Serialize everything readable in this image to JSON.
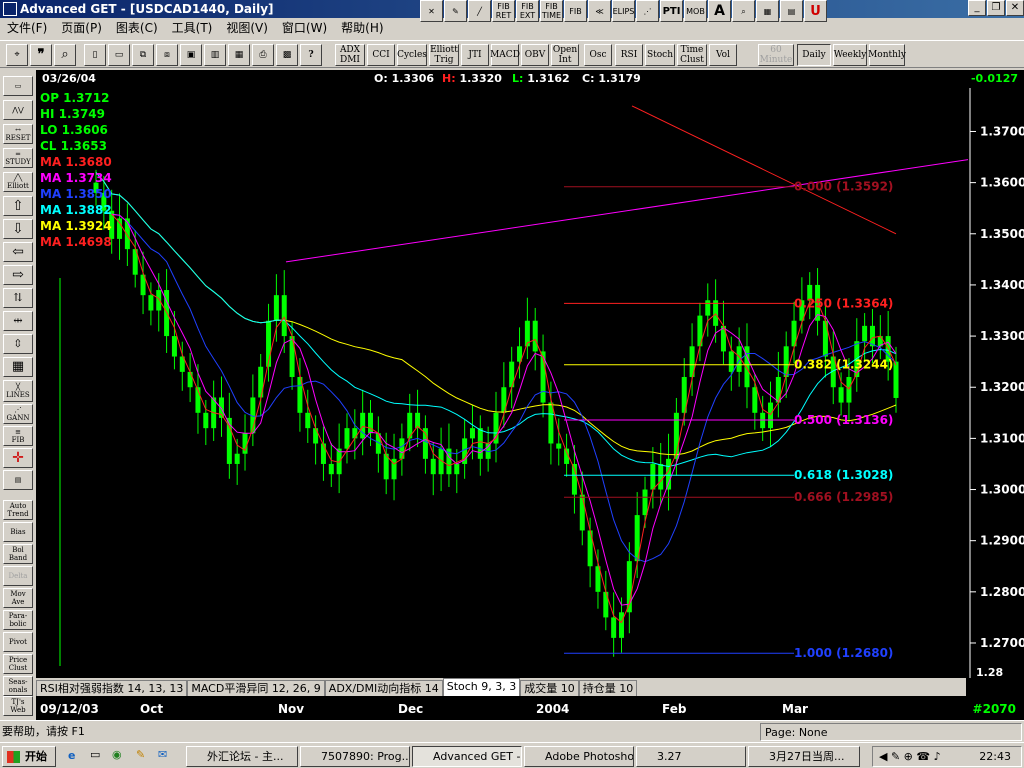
{
  "window": {
    "title": "Advanced GET - [USDCAD1440, Daily]"
  },
  "menu": [
    "文件(F)",
    "页面(P)",
    "图表(C)",
    "工具(T)",
    "视图(V)",
    "窗口(W)",
    "帮助(H)"
  ],
  "top_tools": [
    "FIB RET",
    "FIB EXT",
    "FIB TIME",
    "FIB",
    "ELIPS",
    "PTI",
    "MOB",
    "A"
  ],
  "toolbar2": {
    "indicators": [
      "ADX DMI",
      "CCI",
      "Cycles",
      "Elliott Trig",
      "JTI",
      "MACD",
      "OBV",
      "Open Int",
      "Osc",
      "RSI",
      "Stoch",
      "Time Clust",
      "Vol"
    ],
    "periods": [
      "60 Minute",
      "Daily",
      "Weekly",
      "Monthly"
    ]
  },
  "sidebar": {
    "labels_top": [
      "RESET",
      "STUDY",
      "Elliott",
      "LINES",
      "GANN",
      "FIB"
    ],
    "labels_bottom": [
      "Auto Trend",
      "Bias",
      "Bol Band",
      "Delta",
      "Mov Ave",
      "Para-bolic",
      "Pivot",
      "Price Clust",
      "Seas-onals",
      "TJ's Web"
    ]
  },
  "chart_header": {
    "date": "03/26/04",
    "open_label": "O:",
    "open": "1.3306",
    "high_label": "H:",
    "high": "1.3320",
    "low_label": "L:",
    "low": "1.3162",
    "close_label": "C:",
    "close": "1.3179",
    "change": "-0.0127"
  },
  "legend": [
    {
      "label": "OP",
      "value": "1.3712",
      "color": "#00ff00"
    },
    {
      "label": "HI",
      "value": "1.3749",
      "color": "#00ff00"
    },
    {
      "label": "LO",
      "value": "1.3606",
      "color": "#00ff00"
    },
    {
      "label": "CL",
      "value": "1.3653",
      "color": "#00ff00"
    },
    {
      "label": "MA",
      "value": "1.3680",
      "color": "#ff2020"
    },
    {
      "label": "MA",
      "value": "1.3734",
      "color": "#ff00ff"
    },
    {
      "label": "MA",
      "value": "1.3850",
      "color": "#2040ff"
    },
    {
      "label": "MA",
      "value": "1.3882",
      "color": "#00ffff"
    },
    {
      "label": "MA",
      "value": "1.3924",
      "color": "#ffff00"
    },
    {
      "label": "MA",
      "value": "1.4698",
      "color": "#ff2020"
    }
  ],
  "fib_levels": [
    {
      "label": "0.000 (1.3592)",
      "price": 1.3592,
      "color": "#a01020"
    },
    {
      "label": "0.250 (1.3364)",
      "price": 1.3364,
      "color": "#ff2020"
    },
    {
      "label": "0.382 (1.3244)",
      "price": 1.3244,
      "color": "#ffff00"
    },
    {
      "label": "0.500 (1.3136)",
      "price": 1.3136,
      "color": "#ff00ff"
    },
    {
      "label": "0.618 (1.3028)",
      "price": 1.3028,
      "color": "#00ffff"
    },
    {
      "label": "0.666 (1.2985)",
      "price": 1.2985,
      "color": "#a01020"
    },
    {
      "label": "1.000 (1.2680)",
      "price": 1.268,
      "color": "#2040ff"
    }
  ],
  "study_tabs": [
    "RSI相对强弱指数 14, 13, 13",
    "MACD平滑异同 12, 26, 9",
    "ADX/DMI动向指标 14",
    "Stoch 9, 3, 3",
    "成交量 10",
    "持仓量 10"
  ],
  "date_axis": {
    "start": "09/12/03",
    "ticks": [
      "Oct",
      "Nov",
      "Dec",
      "2004",
      "Feb",
      "Mar"
    ],
    "bar_no": "#2070"
  },
  "status": {
    "help": "要帮助，请按 F1",
    "page": "Page: None"
  },
  "taskbar": {
    "start": "开始",
    "tasks": [
      "外汇论坛 - 主...",
      "7507890: Prog...",
      "Advanced GET -...",
      "Adobe Photoshop",
      "3.27",
      "3月27日当周..."
    ],
    "clock": "22:43"
  },
  "chart_data": {
    "type": "candlestick",
    "symbol": "USDCAD",
    "period": "Daily",
    "y_ticks": [
      1.37,
      1.36,
      1.35,
      1.34,
      1.33,
      1.32,
      1.31,
      1.3,
      1.29,
      1.28,
      1.27
    ],
    "ylim": [
      1.2655,
      1.3785
    ],
    "x_ticks": [
      "Oct",
      "Nov",
      "Dec",
      "2004",
      "Feb",
      "Mar"
    ],
    "ohlc_approx_close": [
      1.358,
      1.3545,
      1.349,
      1.353,
      1.347,
      1.342,
      1.338,
      1.335,
      1.339,
      1.33,
      1.326,
      1.323,
      1.32,
      1.315,
      1.312,
      1.318,
      1.314,
      1.305,
      1.307,
      1.311,
      1.318,
      1.324,
      1.333,
      1.338,
      1.33,
      1.322,
      1.315,
      1.312,
      1.309,
      1.305,
      1.303,
      1.308,
      1.312,
      1.31,
      1.315,
      1.311,
      1.307,
      1.302,
      1.306,
      1.31,
      1.315,
      1.312,
      1.306,
      1.303,
      1.308,
      1.303,
      1.305,
      1.31,
      1.312,
      1.306,
      1.309,
      1.315,
      1.32,
      1.325,
      1.328,
      1.333,
      1.327,
      1.317,
      1.309,
      1.308,
      1.305,
      1.299,
      1.292,
      1.285,
      1.28,
      1.275,
      1.271,
      1.276,
      1.286,
      1.295,
      1.3,
      1.305,
      1.3,
      1.306,
      1.315,
      1.322,
      1.328,
      1.334,
      1.337,
      1.332,
      1.327,
      1.323,
      1.328,
      1.32,
      1.315,
      1.312,
      1.317,
      1.322,
      1.328,
      1.333,
      1.337,
      1.34,
      1.333,
      1.326,
      1.32,
      1.317,
      1.322,
      1.329,
      1.332,
      1.328,
      1.33,
      1.325,
      1.3179
    ],
    "overlays": [
      {
        "name": "MA",
        "color": "#ffff00"
      },
      {
        "name": "MA",
        "color": "#00ffff"
      },
      {
        "name": "MA",
        "color": "#2040ff"
      },
      {
        "name": "MA",
        "color": "#ff00ff"
      },
      {
        "name": "MA",
        "color": "#ff2020"
      },
      {
        "name": "MA",
        "color": "#ff2020"
      }
    ],
    "price_scale_bottom": "1.28",
    "osc_scale": "52.00"
  }
}
